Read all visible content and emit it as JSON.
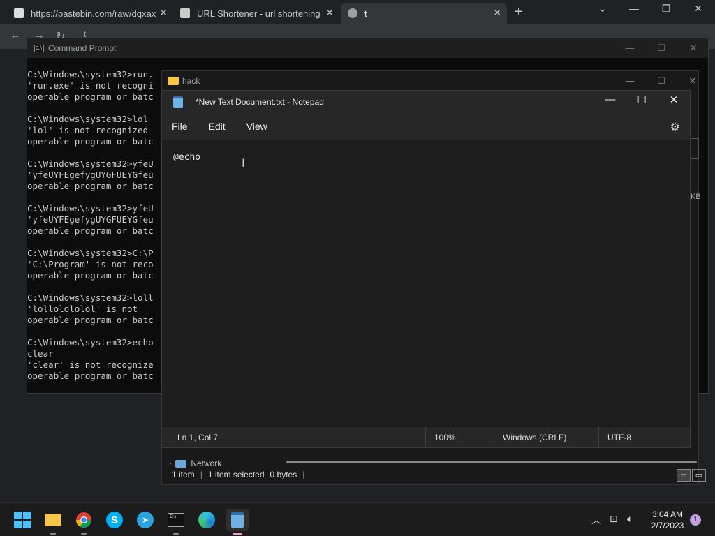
{
  "browser": {
    "tabs": [
      {
        "title": "https://pastebin.com/raw/dqxaxV",
        "icon": "pastebin-icon"
      },
      {
        "title": "URL Shortener - url shortening s",
        "icon": "shortener-icon"
      },
      {
        "title": "t",
        "icon": "globe-icon"
      }
    ],
    "address": "t"
  },
  "cmd": {
    "title": "Command Prompt",
    "lines": "C:\\Windows\\system32>run.\n'run.exe' is not recogni\noperable program or batc\n\nC:\\Windows\\system32>lol\n'lol' is not recognized\noperable program or batc\n\nC:\\Windows\\system32>yfeU\n'yfeUYFEgefygUYGFUEYGfeu\noperable program or batc\n\nC:\\Windows\\system32>yfeU\n'yfeUYFEgefygUYGFUEYGfeu\noperable program or batc\n\nC:\\Windows\\system32>C:\\P\n'C:\\Program' is not reco\noperable program or batc\n\nC:\\Windows\\system32>loll\n'lollolololol' is not\noperable program or batc\n\nC:\\Windows\\system32>echo\nclear\n'clear' is not recognize\noperable program or batc"
  },
  "explorer": {
    "title": "hack",
    "network_label": "Network",
    "status": {
      "items": "1 item",
      "selected": "1 item selected",
      "size": "0 bytes"
    },
    "kb_fragment": "KB"
  },
  "notepad": {
    "title": "*New Text Document.txt - Notepad",
    "menu": {
      "file": "File",
      "edit": "Edit",
      "view": "View"
    },
    "content": "@echo",
    "status": {
      "position": "Ln 1, Col 7",
      "zoom": "100%",
      "line_ending": "Windows (CRLF)",
      "encoding": "UTF-8"
    }
  },
  "taskbar": {
    "time": "3:04 AM",
    "date": "2/7/2023",
    "notification_count": "1"
  }
}
